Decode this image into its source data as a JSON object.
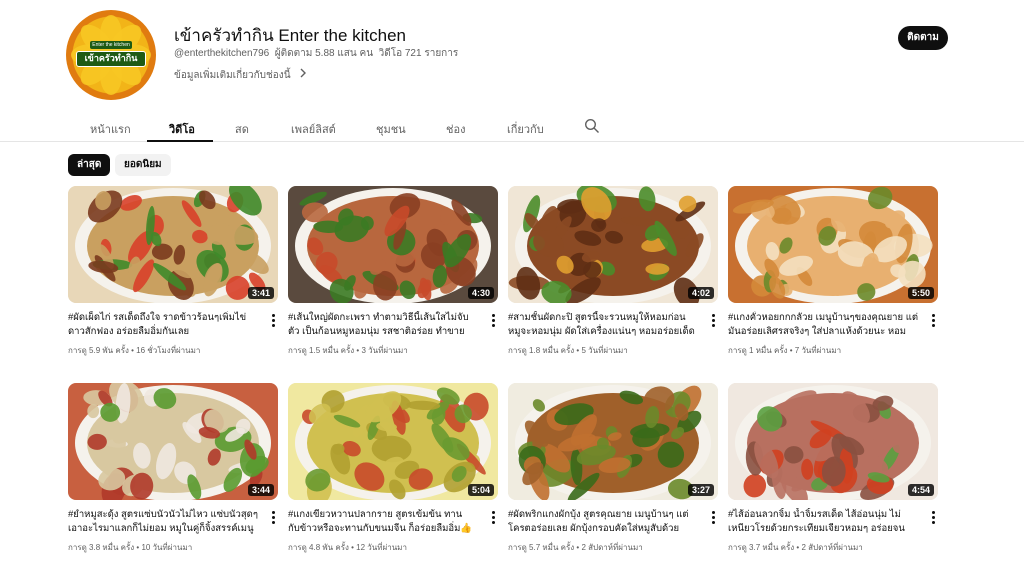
{
  "channel": {
    "name": "เข้าครัวทำกิน Enter the kitchen",
    "handle": "@enterthekitchen796",
    "subscribers": "ผู้ติดตาม 5.88 แสน คน",
    "video_count": "วิดีโอ 721 รายการ",
    "more_info": "ข้อมูลเพิ่มเติมเกี่ยวกับช่องนี้",
    "avatar_text": "เข้าครัวทำกิน",
    "avatar_top_text": "Enter the kitchen",
    "subscribe_label": "ติดตาม"
  },
  "tabs": [
    "หน้าแรก",
    "วิดีโอ",
    "สด",
    "เพลย์ลิสต์",
    "ชุมชน",
    "ช่อง",
    "เกี่ยวกับ"
  ],
  "active_tab": "วิดีโอ",
  "chips": {
    "latest": "ล่าสุด",
    "popular": "ยอดนิยม"
  },
  "videos": [
    {
      "title": "#ผัดเผ็ดไก่ รสเด็ดถึงใจ ราดข้าวร้อนๆเพิ่มไข่ดาวสักฟอง อร่อยลืมอิ่มกันเลย",
      "views": "การดู 5.9 พัน ครั้ง",
      "age": "16 ชั่วโมงที่ผ่านมา",
      "duration": "3:41"
    },
    {
      "title": "#เส้นใหญ่ผัดกะเพรา ทำตามวิธีนี้เส้นใสไม่จับตัว เป็นก้อนหมูหอมนุ่ม รสชาติอร่อย ทำขายเป็นอาชีพได้",
      "views": "การดู 1.5 หมื่น ครั้ง",
      "age": "3 วันที่ผ่านมา",
      "duration": "4:30"
    },
    {
      "title": "#สามชั้นผัดกะปิ สูตรนี้จะรวนหมูให้หอมก่อน หมูจะหอมนุ่ม ผัดใส่เครื่องแน่นๆ หอมอร่อยเด็ดทุกคำ",
      "views": "การดู 1.8 หมื่น ครั้ง",
      "age": "5 วันที่ผ่านมา",
      "duration": "4:02"
    },
    {
      "title": "#แกงคั่วหอยกกกลัวย เมนูบ้านๆของคุณยาย แต่มันอร่อยเลิศรสจริงๆ ใส่ปลาแห้งด้วยนะ หอมอร่อยกินเพลิน",
      "views": "การดู 1 หมื่น ครั้ง",
      "age": "7 วันที่ผ่านมา",
      "duration": "5:50"
    },
    {
      "title": "#ยำหมูสะดุ้ง สูตรแซ่บนัวนัวไม่ไหว แซ่บนัวสุดๆ เอาอะไรมาแลกก็ไม่ยอม หมูในคู่ก็จิ้งสรรค์เมนูแซ่บ",
      "views": "การดู 3.8 หมื่น ครั้ง",
      "age": "10 วันที่ผ่านมา",
      "duration": "3:44"
    },
    {
      "title": "#แกงเขียวหวานปลากราย สูตรเข้มข้น ทานกับข้าวหรือจะทานกับขนมจีน ก็อร่อยลืมอิ่ม👍👍",
      "views": "การดู 4.8 พัน ครั้ง",
      "age": "12 วันที่ผ่านมา",
      "duration": "5:04"
    },
    {
      "title": "#ผัดพริกแกงผักบุ้ง สูตรคุณยาย เมนูบ้านๆ แต่โครตอร่อยเลย ผักบุ้งกรอบคัดใส่หมูสับด้วย ราดข้าวสวย",
      "views": "การดู 5.7 หมื่น ครั้ง",
      "age": "2 สัปดาห์ที่ผ่านมา",
      "duration": "3:27"
    },
    {
      "title": "#ไส้อ่อนลวกจิ้ม น้ำจิ้มรสเด็ด ไส้อ่อนนุ่ม ไม่เหนียวโรยด้วยกระเทียมเจียวหอมๆ อร่อยจนไม่มีคำบรรยาย",
      "views": "การดู 3.7 หมื่น ครั้ง",
      "age": "2 สัปดาห์ที่ผ่านมา",
      "duration": "4:54"
    }
  ],
  "colors": {
    "accent": "#0f0f0f",
    "meta_text": "#606060"
  }
}
